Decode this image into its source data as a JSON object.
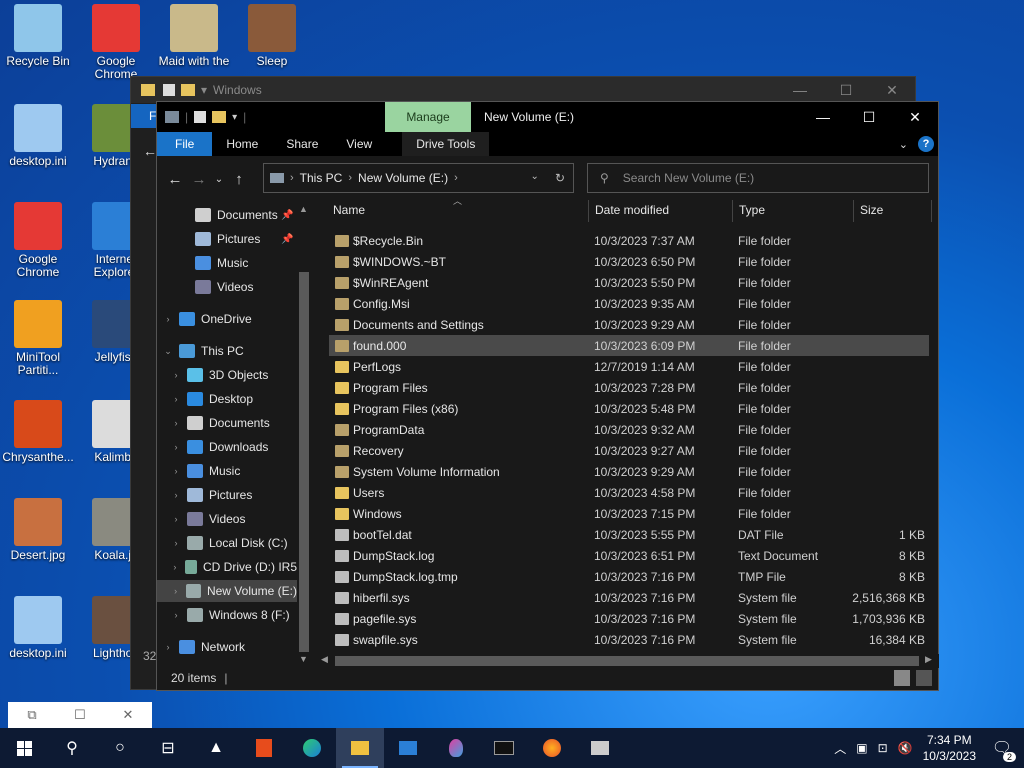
{
  "desktop": {
    "icons": [
      {
        "label": "Recycle Bin",
        "color": "#8fc6ea"
      },
      {
        "label": "Google Chrome",
        "color": "#e53935"
      },
      {
        "label": "Maid with the",
        "color": "#c9b98a"
      },
      {
        "label": "Sleep",
        "color": "#8a5a3a"
      },
      {
        "label": "desktop.ini",
        "color": "#9ec9f0"
      },
      {
        "label": "Hydrang",
        "color": "#6b8e3a"
      },
      {
        "label": "Google Chrome",
        "color": "#e53935"
      },
      {
        "label": "Internet Explorer",
        "color": "#2b7fd6"
      },
      {
        "label": "MiniTool Partiti...",
        "color": "#f0a020"
      },
      {
        "label": "Jellyfish",
        "color": "#2a4a7a"
      },
      {
        "label": "Chrysanthe...",
        "color": "#d84a1a"
      },
      {
        "label": "Kalimba",
        "color": "#dcdcdc"
      },
      {
        "label": "Desert.jpg",
        "color": "#c87040"
      },
      {
        "label": "Koala.jp",
        "color": "#8a8a80"
      },
      {
        "label": "desktop.ini",
        "color": "#9ec9f0"
      },
      {
        "label": "Lighthou",
        "color": "#6a5040"
      }
    ]
  },
  "bg_window": {
    "title": "Windows",
    "strip_label": "F",
    "count_label": "32"
  },
  "window": {
    "title": "New Volume (E:)",
    "manage_label": "Manage",
    "ribbon_tabs": [
      "File",
      "Home",
      "Share",
      "View",
      "Drive Tools"
    ],
    "address": {
      "crumbs": [
        "This PC",
        "New Volume (E:)"
      ]
    },
    "search_placeholder": "Search New Volume (E:)",
    "status_text": "20 items"
  },
  "nav": [
    {
      "label": "Documents",
      "color": "#cfcfcf",
      "pinned": true
    },
    {
      "label": "Pictures",
      "color": "#9fb9d9",
      "pinned": true
    },
    {
      "label": "Music",
      "color": "#4a8fe0"
    },
    {
      "label": "Videos",
      "color": "#7a7a9a"
    },
    {
      "label": "OneDrive",
      "color": "#3a8fe0"
    },
    {
      "label": "This PC",
      "color": "#4a9ad8"
    },
    {
      "label": "3D Objects",
      "color": "#5ac0e8"
    },
    {
      "label": "Desktop",
      "color": "#2a8ae0"
    },
    {
      "label": "Documents",
      "color": "#cfcfcf"
    },
    {
      "label": "Downloads",
      "color": "#3a8fe0"
    },
    {
      "label": "Music",
      "color": "#4a8fe0"
    },
    {
      "label": "Pictures",
      "color": "#9fb9d9"
    },
    {
      "label": "Videos",
      "color": "#7a7a9a"
    },
    {
      "label": "Local Disk (C:)",
      "color": "#9aa"
    },
    {
      "label": "CD Drive (D:) IR5",
      "color": "#7a9"
    },
    {
      "label": "New Volume (E:)",
      "color": "#9aa"
    },
    {
      "label": "Windows 8 (F:)",
      "color": "#9aa"
    },
    {
      "label": "Network",
      "color": "#4a8fe0"
    }
  ],
  "columns": {
    "name": "Name",
    "date": "Date modified",
    "type": "Type",
    "size": "Size"
  },
  "files": [
    {
      "name": "$Recycle.Bin",
      "date": "10/3/2023 7:37 AM",
      "type": "File folder",
      "size": "",
      "kind": "folder-dim"
    },
    {
      "name": "$WINDOWS.~BT",
      "date": "10/3/2023 6:50 PM",
      "type": "File folder",
      "size": "",
      "kind": "folder-dim"
    },
    {
      "name": "$WinREAgent",
      "date": "10/3/2023 5:50 PM",
      "type": "File folder",
      "size": "",
      "kind": "folder-dim"
    },
    {
      "name": "Config.Msi",
      "date": "10/3/2023 9:35 AM",
      "type": "File folder",
      "size": "",
      "kind": "folder-dim"
    },
    {
      "name": "Documents and Settings",
      "date": "10/3/2023 9:29 AM",
      "type": "File folder",
      "size": "",
      "kind": "folder-dim"
    },
    {
      "name": "found.000",
      "date": "10/3/2023 6:09 PM",
      "type": "File folder",
      "size": "",
      "kind": "folder-dim"
    },
    {
      "name": "PerfLogs",
      "date": "12/7/2019 1:14 AM",
      "type": "File folder",
      "size": "",
      "kind": "folder"
    },
    {
      "name": "Program Files",
      "date": "10/3/2023 7:28 PM",
      "type": "File folder",
      "size": "",
      "kind": "folder"
    },
    {
      "name": "Program Files (x86)",
      "date": "10/3/2023 5:48 PM",
      "type": "File folder",
      "size": "",
      "kind": "folder"
    },
    {
      "name": "ProgramData",
      "date": "10/3/2023 9:32 AM",
      "type": "File folder",
      "size": "",
      "kind": "folder-dim"
    },
    {
      "name": "Recovery",
      "date": "10/3/2023 9:27 AM",
      "type": "File folder",
      "size": "",
      "kind": "folder-dim"
    },
    {
      "name": "System Volume Information",
      "date": "10/3/2023 9:29 AM",
      "type": "File folder",
      "size": "",
      "kind": "folder-dim"
    },
    {
      "name": "Users",
      "date": "10/3/2023 4:58 PM",
      "type": "File folder",
      "size": "",
      "kind": "folder"
    },
    {
      "name": "Windows",
      "date": "10/3/2023 7:15 PM",
      "type": "File folder",
      "size": "",
      "kind": "folder"
    },
    {
      "name": "bootTel.dat",
      "date": "10/3/2023 5:55 PM",
      "type": "DAT File",
      "size": "1 KB",
      "kind": "file"
    },
    {
      "name": "DumpStack.log",
      "date": "10/3/2023 6:51 PM",
      "type": "Text Document",
      "size": "8 KB",
      "kind": "file"
    },
    {
      "name": "DumpStack.log.tmp",
      "date": "10/3/2023 7:16 PM",
      "type": "TMP File",
      "size": "8 KB",
      "kind": "file"
    },
    {
      "name": "hiberfil.sys",
      "date": "10/3/2023 7:16 PM",
      "type": "System file",
      "size": "2,516,368 KB",
      "kind": "file"
    },
    {
      "name": "pagefile.sys",
      "date": "10/3/2023 7:16 PM",
      "type": "System file",
      "size": "1,703,936 KB",
      "kind": "file"
    },
    {
      "name": "swapfile.sys",
      "date": "10/3/2023 7:16 PM",
      "type": "System file",
      "size": "16,384 KB",
      "kind": "file"
    }
  ],
  "selected_file": "found.000",
  "taskbar": {
    "time": "7:34 PM",
    "date": "10/3/2023",
    "notif_count": "2",
    "accent": "#0d1a33"
  }
}
